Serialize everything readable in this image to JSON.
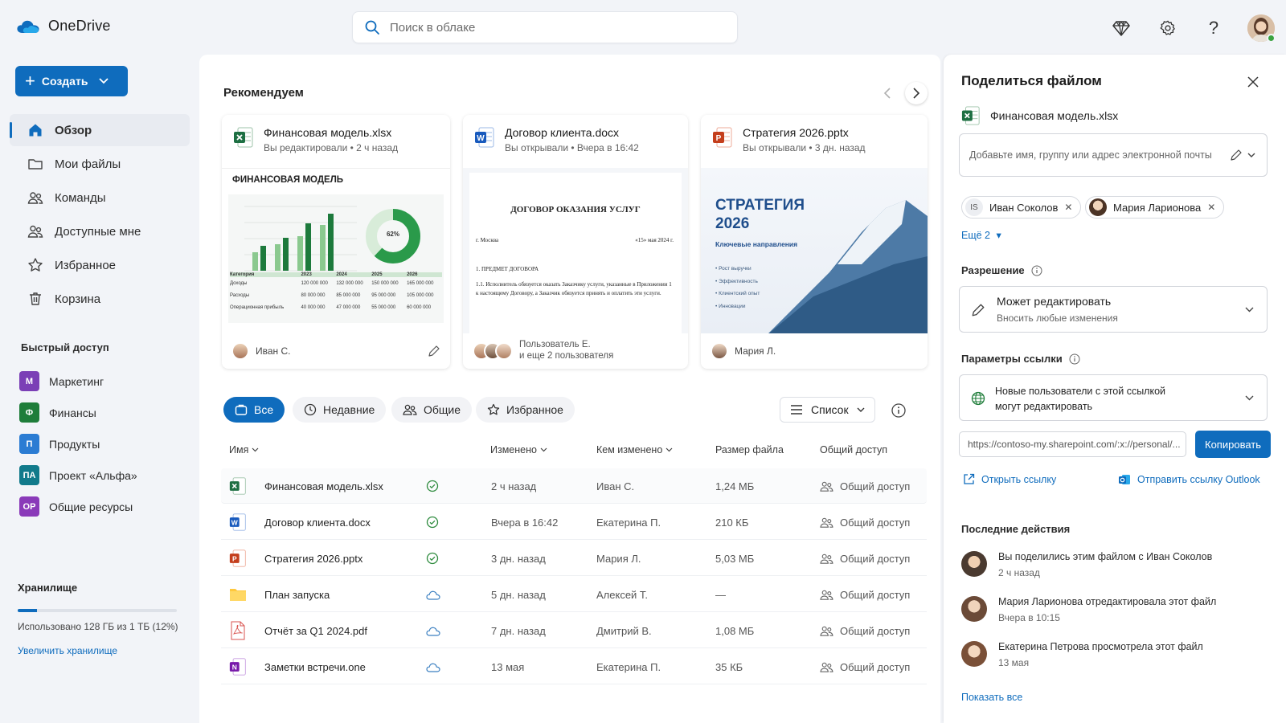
{
  "app": {
    "name": "OneDrive"
  },
  "search": {
    "placeholder": "Поиск в облаке"
  },
  "sidebar": {
    "create_label": "Создать",
    "nav": [
      {
        "label": "Обзор",
        "icon": "home-icon"
      },
      {
        "label": "Мои файлы",
        "icon": "folder-icon"
      },
      {
        "label": "Команды",
        "icon": "people-icon"
      },
      {
        "label": "Доступные мне",
        "icon": "shared-icon"
      },
      {
        "label": "Избранное",
        "icon": "star-icon"
      },
      {
        "label": "Корзина",
        "icon": "trash-icon"
      }
    ],
    "quick_title": "Быстрый доступ",
    "quick": [
      {
        "badge": "М",
        "label": "Маркетинг",
        "color": "#7b3fb6"
      },
      {
        "badge": "Ф",
        "label": "Финансы",
        "color": "#1f7d3a"
      },
      {
        "badge": "П",
        "label": "Продукты",
        "color": "#2b7cd3"
      },
      {
        "badge": "ПА",
        "label": "Проект «Альфа»",
        "color": "#117a8b"
      },
      {
        "badge": "ОР",
        "label": "Общие ресурсы",
        "color": "#8a3ab9"
      }
    ],
    "storage": {
      "title": "Хранилище",
      "used_fraction": 0.12,
      "used_text": "Использовано 128 ГБ из 1 ТБ (12%)",
      "upgrade": "Увеличить хранилище"
    }
  },
  "recommended": {
    "title": "Рекомендуем",
    "cards": [
      {
        "name": "Финансовая модель.xlsx",
        "sub": "Вы редактировали • 2 ч назад",
        "owner": "Иван С.",
        "preview": {
          "heading": "ФИНАНСОВАЯ МОДЕЛЬ",
          "donut_label": "62%",
          "table_header": [
            "Категория",
            "2023",
            "2024",
            "2025",
            "2026"
          ],
          "table_rows": [
            [
              "Доходы",
              "120 000 000",
              "132 000 000",
              "150 000 000",
              "165 000 000"
            ],
            [
              "Расходы",
              "80 000 000",
              "85 000 000",
              "95 000 000",
              "105 000 000"
            ],
            [
              "Операционная прибыль",
              "40 000 000",
              "47 000 000",
              "55 000 000",
              "60 000 000"
            ]
          ]
        }
      },
      {
        "name": "Договор клиента.docx",
        "sub": "Вы открывали • Вчера в 16:42",
        "owner_line1": "Пользователь Е.",
        "owner_line2": "и еще 2 пользователя",
        "preview": {
          "heading": "ДОГОВОР ОКАЗАНИЯ УСЛУГ",
          "city": "г. Москва",
          "date": "«15» мая 2024 г.",
          "section": "1. ПРЕДМЕТ ДОГОВОРА",
          "text": "1.1. Исполнитель обязуется оказать Заказчику услуги, указанные в Приложении 1 к настоящему Договору, а Заказчик обязуется принять и оплатить эти услуги."
        }
      },
      {
        "name": "Стратегия 2026.pptx",
        "sub": "Вы открывали • 3 дн. назад",
        "owner": "Мария Л.",
        "preview": {
          "title1": "СТРАТЕГИЯ",
          "title2": "2026",
          "subtitle": "Ключевые направления",
          "bullets": [
            "Рост выручки",
            "Эффективность",
            "Клиентский опыт",
            "Инновации"
          ]
        }
      }
    ]
  },
  "filters": [
    {
      "label": "Все",
      "icon": "briefcase-icon"
    },
    {
      "label": "Недавние",
      "icon": "clock-icon"
    },
    {
      "label": "Общие",
      "icon": "people-icon"
    },
    {
      "label": "Избранное",
      "icon": "star-icon"
    }
  ],
  "view": {
    "label": "Список"
  },
  "table": {
    "headers": {
      "name": "Имя",
      "modified": "Изменено",
      "modified_by": "Кем изменено",
      "size": "Размер файла",
      "sharing": "Общий доступ"
    },
    "rows": [
      {
        "name": "Финансовая модель.xlsx",
        "type": "xlsx",
        "status": "synced",
        "modified": "2 ч назад",
        "by": "Иван С.",
        "size": "1,24 МБ",
        "sharing": "Общий доступ"
      },
      {
        "name": "Договор клиента.docx",
        "type": "docx",
        "status": "synced",
        "modified": "Вчера в 16:42",
        "by": "Екатерина П.",
        "size": "210 КБ",
        "sharing": "Общий доступ"
      },
      {
        "name": "Стратегия 2026.pptx",
        "type": "pptx",
        "status": "synced",
        "modified": "3 дн. назад",
        "by": "Мария Л.",
        "size": "5,03 МБ",
        "sharing": "Общий доступ"
      },
      {
        "name": "План запуска",
        "type": "folder",
        "status": "cloud",
        "modified": "5 дн. назад",
        "by": "Алексей Т.",
        "size": "—",
        "sharing": "Общий доступ"
      },
      {
        "name": "Отчёт за Q1 2024.pdf",
        "type": "pdf",
        "status": "cloud",
        "modified": "7 дн. назад",
        "by": "Дмитрий В.",
        "size": "1,08 МБ",
        "sharing": "Общий доступ"
      },
      {
        "name": "Заметки встречи.one",
        "type": "one",
        "status": "cloud",
        "modified": "13 мая",
        "by": "Екатерина П.",
        "size": "35 КБ",
        "sharing": "Общий доступ"
      }
    ]
  },
  "share": {
    "title": "Поделиться файлом",
    "file": "Финансовая модель.xlsx",
    "input_placeholder": "Добавьте имя, группу или адрес электронной почты",
    "chips": [
      {
        "initials": "IS",
        "name": "Иван Соколов"
      },
      {
        "name": "Мария Ларионова"
      }
    ],
    "more": "Ещё 2",
    "permission_title": "Разрешение",
    "permission_main": "Может редактировать",
    "permission_sub": "Вносить любые изменения",
    "link_title": "Параметры ссылки",
    "link_line1": "Новые пользователи с этой ссылкой",
    "link_line2": "могут редактировать",
    "url": "https://contoso-my.sharepoint.com/:x://personal/...",
    "copy": "Копировать",
    "open_link": "Открыть ссылку",
    "outlook_link": "Отправить ссылку Outlook",
    "activity_title": "Последние действия",
    "activity": [
      {
        "text": "Вы поделились этим файлом с Иван Соколов",
        "time": "2 ч назад"
      },
      {
        "text": "Мария Ларионова отредактировала этот файл",
        "time": "Вчера в 10:15"
      },
      {
        "text": "Екатерина Петрова просмотрела этот файл",
        "time": "13 мая"
      }
    ],
    "show_all": "Показать все"
  },
  "colors": {
    "accent": "#0f6cbd",
    "excel": "#1d6f42",
    "word": "#185abd",
    "ppt": "#c43e1c",
    "onenote": "#7719aa"
  }
}
